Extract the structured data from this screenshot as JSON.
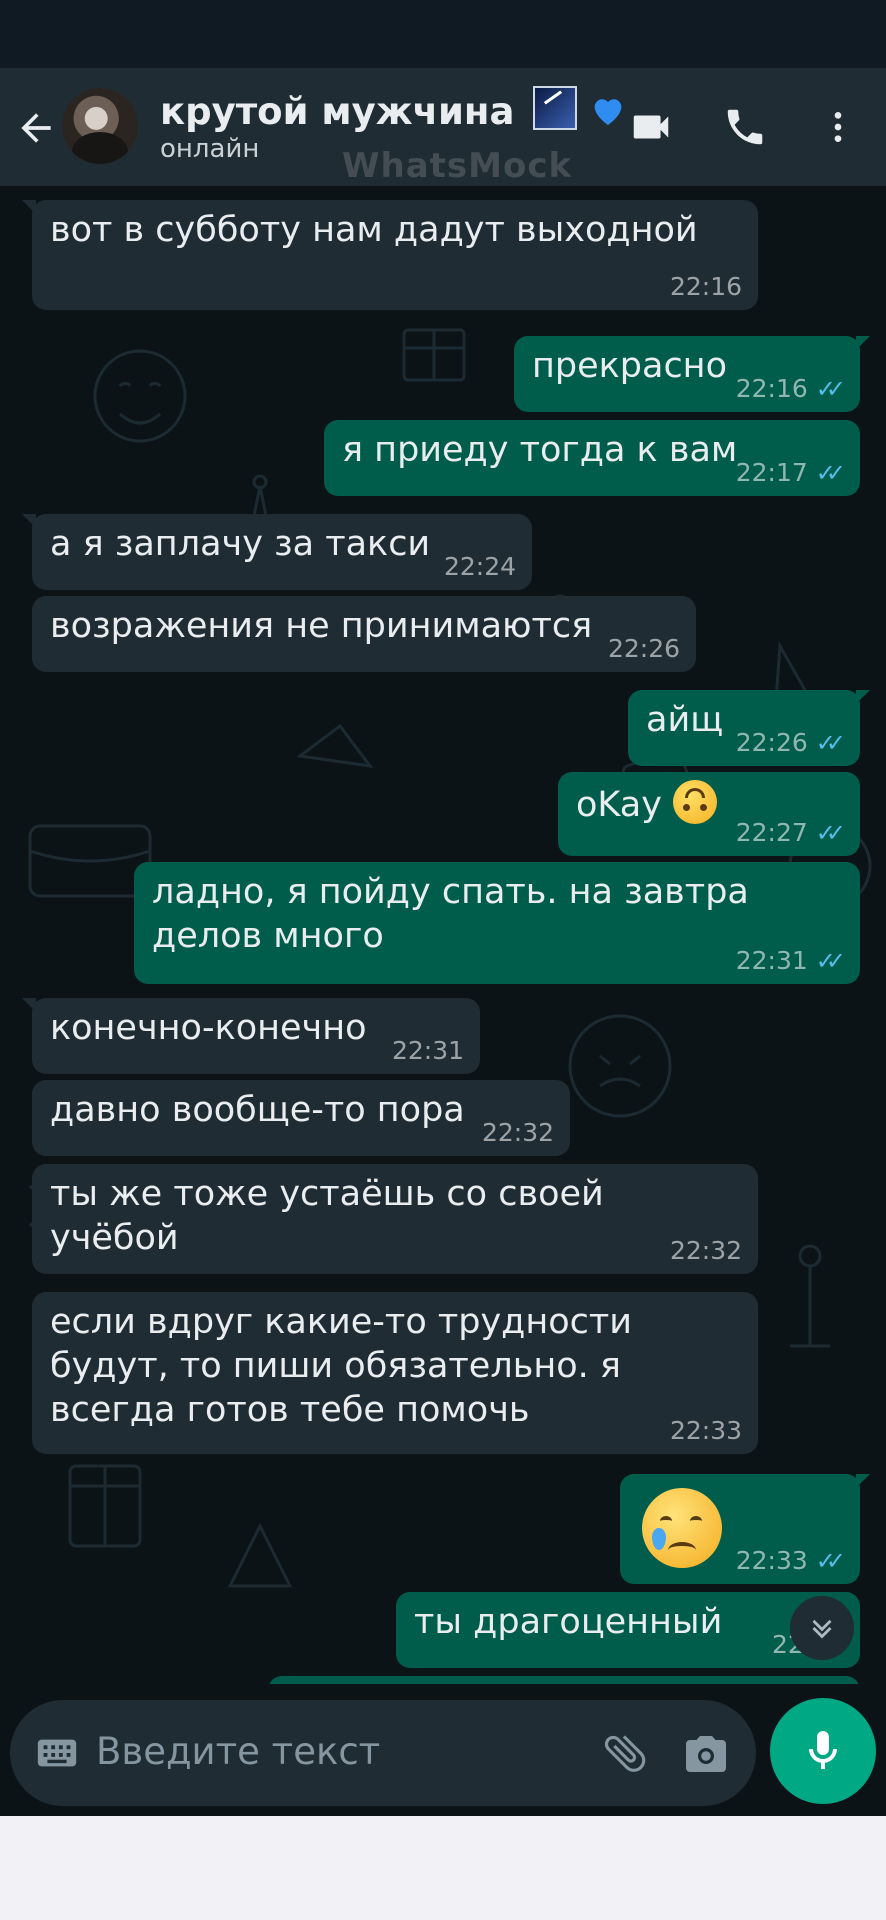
{
  "header": {
    "contact_name": "крутой мужчина",
    "status": "онлайн",
    "watermark": "WhatsMock"
  },
  "messages": [
    {
      "dir": "in",
      "text": "вот в субботу нам дадут выходной",
      "time": "22:16"
    },
    {
      "dir": "out",
      "text": "прекрасно",
      "time": "22:16"
    },
    {
      "dir": "out",
      "text": "я приеду тогда к вам",
      "time": "22:17"
    },
    {
      "dir": "in",
      "text": "а я заплачу за такси",
      "time": "22:24"
    },
    {
      "dir": "in",
      "text": "возражения не принимаются",
      "time": "22:26"
    },
    {
      "dir": "out",
      "text": "айщ",
      "time": "22:26"
    },
    {
      "dir": "out",
      "text": "oKay",
      "time": "22:27"
    },
    {
      "dir": "out",
      "text": "ладно, я пойду спать. на завтра делов много",
      "time": "22:31"
    },
    {
      "dir": "in",
      "text": "конечно-конечно",
      "time": "22:31"
    },
    {
      "dir": "in",
      "text": "давно вообще-то пора",
      "time": "22:32"
    },
    {
      "dir": "in",
      "text": "ты же тоже устаёшь со своей учёбой",
      "time": "22:32"
    },
    {
      "dir": "in",
      "text": "если вдруг какие-то трудности будут, то пиши обязательно. я всегда готов тебе помочь",
      "time": "22:33"
    },
    {
      "dir": "out",
      "text": "",
      "time": "22:33"
    },
    {
      "dir": "out",
      "text": "ты драгоценный",
      "time": "22:33"
    }
  ],
  "composer": {
    "placeholder": "Введите текст"
  },
  "colors": {
    "header_bg": "#1f2c33",
    "chat_bg": "#0c1317",
    "incoming_bubble": "#202c33",
    "outgoing_bubble": "#005c4b",
    "read_tick": "#53bdeb",
    "mic_button": "#00a884"
  },
  "icons": [
    "back-arrow-icon",
    "video-call-icon",
    "phone-icon",
    "more-vert-icon",
    "keyboard-icon",
    "attach-icon",
    "camera-icon",
    "mic-icon",
    "scroll-down-icon",
    "sparkle-emoji",
    "blue-heart-emoji",
    "upside-down-face-emoji",
    "crying-face-emoji"
  ]
}
